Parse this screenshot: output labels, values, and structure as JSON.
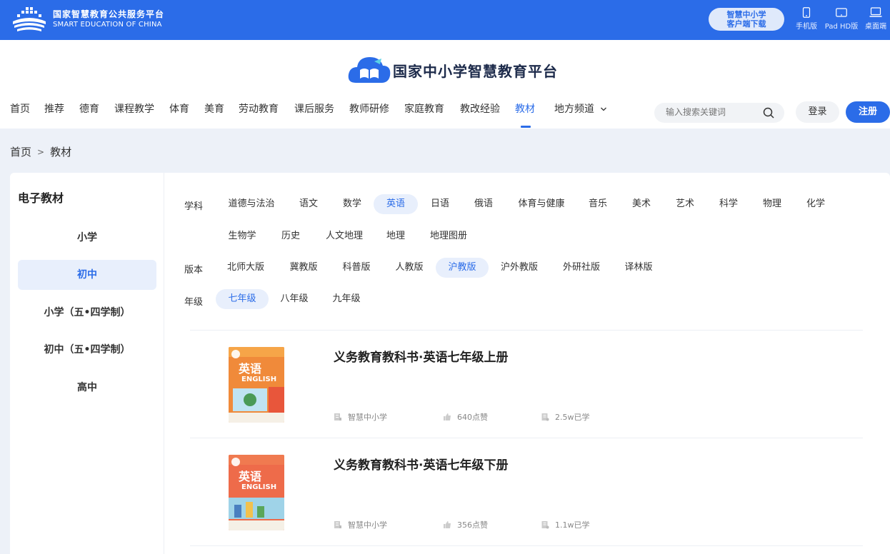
{
  "topbar": {
    "brand_cn": "国家智慧教育公共服务平台",
    "brand_en": "SMART EDUCATION OF CHINA",
    "download_line1": "智慧中小学",
    "download_line2": "客户端下载",
    "devices": [
      {
        "label": "手机版",
        "icon": "phone-icon"
      },
      {
        "label": "Pad HD版",
        "icon": "tablet-icon"
      },
      {
        "label": "桌面端",
        "icon": "desktop-icon"
      }
    ]
  },
  "header": {
    "site_title": "国家中小学智慧教育平台",
    "nav": [
      "首页",
      "推荐",
      "德育",
      "课程教学",
      "体育",
      "美育",
      "劳动教育",
      "课后服务",
      "教师研修",
      "家庭教育",
      "教改经验",
      "教材",
      "地方频道"
    ],
    "active_nav": "教材",
    "search_placeholder": "输入搜索关键词",
    "login": "登录",
    "register": "注册"
  },
  "breadcrumb": {
    "home": "首页",
    "separator": ">",
    "current": "教材"
  },
  "sidebar": {
    "title": "电子教材",
    "items": [
      "小学",
      "初中",
      "小学（五•四学制）",
      "初中（五•四学制）",
      "高中"
    ],
    "active": "初中"
  },
  "filters": {
    "subject_label": "学科",
    "subjects": [
      "道德与法治",
      "语文",
      "数学",
      "英语",
      "日语",
      "俄语",
      "体育与健康",
      "音乐",
      "美术",
      "艺术",
      "科学",
      "物理",
      "化学",
      "生物学",
      "历史",
      "人文地理",
      "地理",
      "地理图册"
    ],
    "active_subject": "英语",
    "edition_label": "版本",
    "editions": [
      "北师大版",
      "冀教版",
      "科普版",
      "人教版",
      "沪教版",
      "沪外教版",
      "外研社版",
      "译林版"
    ],
    "active_edition": "沪教版",
    "grade_label": "年级",
    "grades": [
      "七年级",
      "八年级",
      "九年级"
    ],
    "active_grade": "七年级"
  },
  "books": [
    {
      "title": "义务教育教科书·英语七年级上册",
      "publisher": "智慧中小学",
      "likes": "640点赞",
      "learners": "2.5w已学",
      "cover_text_cn": "英语",
      "cover_text_en": "ENGLISH",
      "cover_color": "#f08a3a"
    },
    {
      "title": "义务教育教科书·英语七年级下册",
      "publisher": "智慧中小学",
      "likes": "356点赞",
      "learners": "1.1w已学",
      "cover_text_cn": "英语",
      "cover_text_en": "ENGLISH",
      "cover_color": "#ee6b4a"
    }
  ],
  "colors": {
    "brand": "#2b6ce8",
    "active_bg": "#e8effc",
    "page_bg": "#edf1f8"
  }
}
